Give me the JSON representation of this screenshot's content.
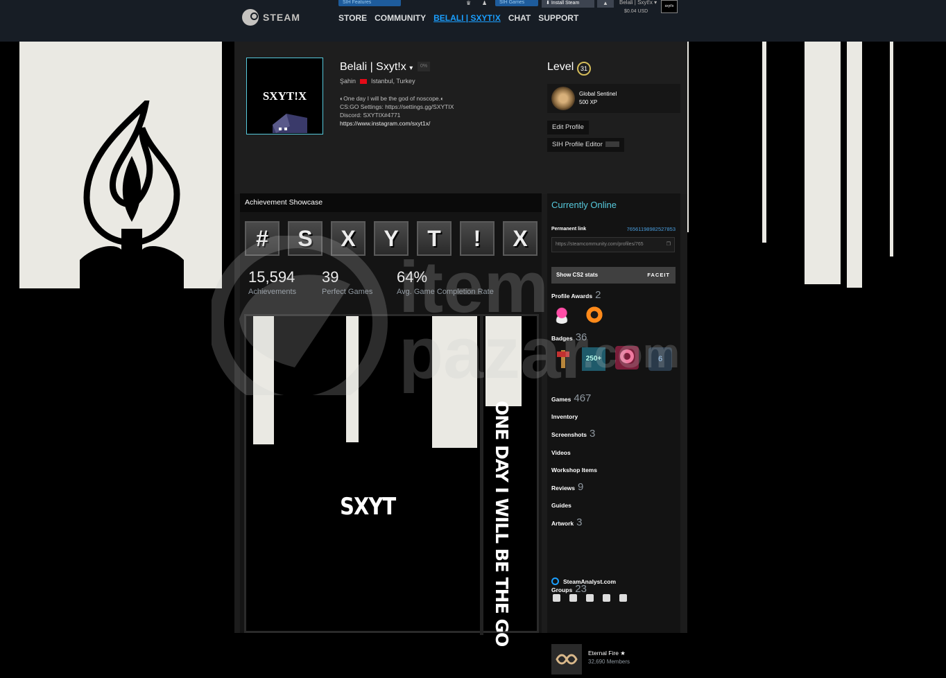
{
  "header": {
    "logo_text": "STEAM",
    "nav": [
      "STORE",
      "COMMUNITY",
      "BELALI | SXYT!X",
      "CHAT",
      "SUPPORT"
    ],
    "sih_features": "SIH Features",
    "sih_games": "SIH Games",
    "install_steam": "Install Steam",
    "account_name": "Belali | Sxyt!x",
    "wallet": "$0.04 USD"
  },
  "profile": {
    "avatar_text": "SXYT!X",
    "name": "Belali | Sxyt!x",
    "percent_badge": "0%",
    "real_name": "Şahin",
    "location": "Istanbul, Turkey",
    "summary": [
      "One day I will be the god of noscope.",
      "CS:GO Settings: https://settings.gg/SXYTIX",
      "Discord: SXYTIX#4771",
      "https://www.instagram.com/sxyt1x/"
    ],
    "level_label": "Level",
    "level": "31",
    "badge_name": "Global Sentinel",
    "badge_xp": "500 XP",
    "edit_profile": "Edit Profile",
    "sih_editor": "SIH Profile Editor"
  },
  "showcase": {
    "title": "Achievement Showcase",
    "tiles": [
      "#",
      "S",
      "X",
      "Y",
      "T",
      "!",
      "X"
    ],
    "stats": [
      {
        "value": "15,594",
        "label": "Achievements"
      },
      {
        "value": "39",
        "label": "Perfect Games"
      },
      {
        "value": "64%",
        "label": "Avg. Game Completion Rate"
      }
    ],
    "artwork_title": "SXYT",
    "artwork_vertical": "ONE DAY I WILL BE THE GO"
  },
  "sidebar": {
    "status": "Currently Online",
    "permanent_link_label": "Permanent link",
    "permanent_link_id": "76561198982527853",
    "permanent_link_url": "https://steamcommunity.com/profiles/765",
    "cs2_stats": "Show CS2 stats",
    "faceit": "FACEIT",
    "profile_awards": {
      "label": "Profile Awards",
      "count": "2"
    },
    "badges": {
      "label": "Badges",
      "count": "36"
    },
    "badge_250": "250+",
    "badge_6": "6",
    "games": {
      "label": "Games",
      "count": "467"
    },
    "inventory": "Inventory",
    "screenshots": {
      "label": "Screenshots",
      "count": "3"
    },
    "videos": "Videos",
    "workshop": "Workshop Items",
    "reviews": {
      "label": "Reviews",
      "count": "9"
    },
    "guides": "Guides",
    "artwork": {
      "label": "Artwork",
      "count": "3"
    },
    "steamanalyst": "SteamAnalyst.com",
    "groups": {
      "label": "Groups",
      "count": "23"
    },
    "group_name": "Eternal Fire ★",
    "group_members": "32,690 Members"
  },
  "watermark": {
    "brand": "item",
    "brand2": "pazar",
    "domain": ".com"
  },
  "colors": {
    "accent": "#1a9fff",
    "online": "#57cbde",
    "bg": "#1c1c1c"
  }
}
